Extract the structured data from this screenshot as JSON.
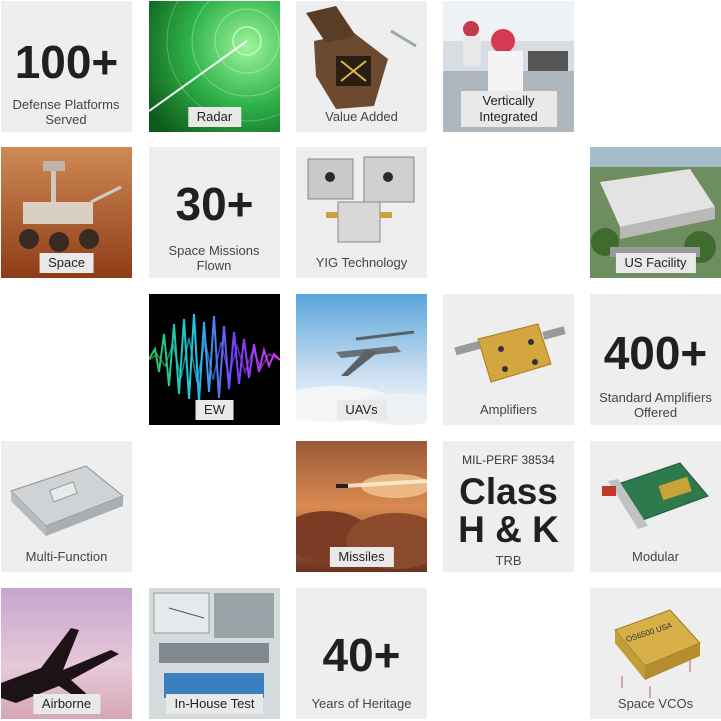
{
  "tiles": {
    "defense": {
      "stat": "100+",
      "caption": "Defense Platforms Served"
    },
    "radar": {
      "label": "Radar"
    },
    "value_added": {
      "label": "Value Added"
    },
    "vertically": {
      "label": "Vertically Integrated"
    },
    "space": {
      "label": "Space"
    },
    "missions": {
      "stat": "30+",
      "caption": "Space Missions Flown"
    },
    "yig": {
      "label": "YIG Technology"
    },
    "us_facility": {
      "label": "US Facility"
    },
    "ew": {
      "label": "EW"
    },
    "uavs": {
      "label": "UAVs"
    },
    "amplifiers": {
      "label": "Amplifiers"
    },
    "standard_amps": {
      "stat": "400+",
      "caption": "Standard Amplifiers Offered"
    },
    "multi_function": {
      "label": "Multi-Function"
    },
    "missiles": {
      "label": "Missiles"
    },
    "milperf": {
      "top": "MIL-PERF 38534",
      "line1": "Class",
      "line2": "H & K",
      "caption": "TRB"
    },
    "modular": {
      "label": "Modular"
    },
    "airborne": {
      "label": "Airborne"
    },
    "inhouse": {
      "label": "In-House Test"
    },
    "heritage": {
      "stat": "40+",
      "caption": "Years of Heritage"
    },
    "space_vcos": {
      "label": "Space VCOs",
      "chip_text": "OS6500 USA"
    }
  },
  "colors": {
    "tile_bg": "#eeeeee",
    "text_dark": "#231f20",
    "radar_green": "#3ec45a"
  }
}
